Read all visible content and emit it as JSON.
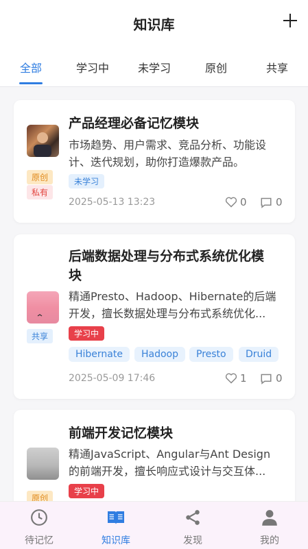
{
  "header": {
    "title": "知识库",
    "add_icon": "plus-icon"
  },
  "tabs": [
    "全部",
    "学习中",
    "未学习",
    "原创",
    "共享"
  ],
  "active_tab": "全部",
  "cards": [
    {
      "title": "产品经理必备记忆模块",
      "description_lines": [
        "市场趋势、用户需求、竞品分析、功能设",
        "计、迭代规划，助你打造爆款产品。"
      ],
      "badges": [
        "原创",
        "私有"
      ],
      "status": "未学习",
      "tags": [],
      "date": "2025-05-13 13:23",
      "likes": "0",
      "comments": "0"
    },
    {
      "title_lines": [
        "后端数据处理与分布式系统优化模",
        "块"
      ],
      "description_lines": [
        "精通Presto、Hadoop、Hibernate的后端",
        "开发，擅长数据处理与分布式系统优化..."
      ],
      "badges": [
        "共享"
      ],
      "status": "学习中",
      "tags": [
        "Hibernate",
        "Hadoop",
        "Presto",
        "Druid"
      ],
      "date": "2025-05-09 17:46",
      "likes": "1",
      "comments": "0"
    },
    {
      "title": "前端开发记忆模块",
      "description_lines": [
        "精通JavaScript、Angular与Ant Design",
        "的前端开发，擅长响应式设计与交互体..."
      ],
      "badges": [
        "原创"
      ],
      "status": "学习中"
    }
  ],
  "bottom_nav": [
    {
      "label": "待记忆",
      "icon": "clock-icon"
    },
    {
      "label": "知识库",
      "icon": "book-icon"
    },
    {
      "label": "发现",
      "icon": "share-icon"
    },
    {
      "label": "我的",
      "icon": "user-icon"
    }
  ],
  "colors": {
    "accent": "#2f7de1",
    "learning": "#e8404a",
    "original": "#e08a1c"
  }
}
